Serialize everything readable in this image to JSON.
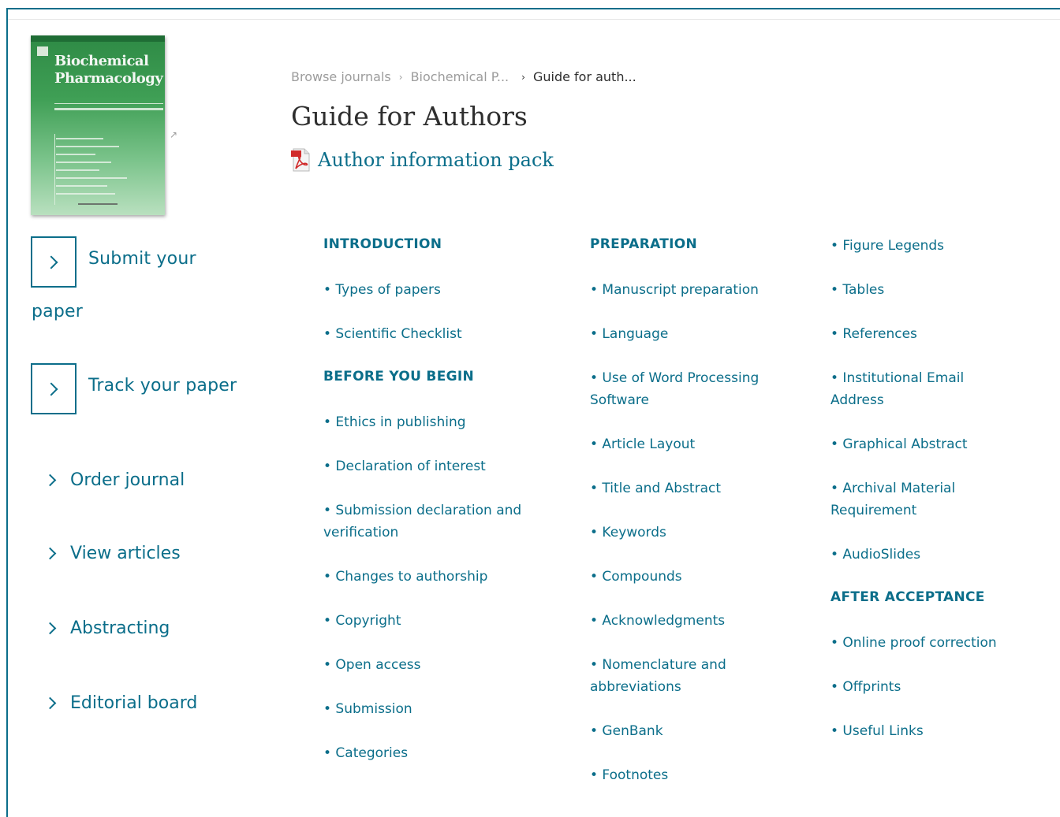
{
  "cover": {
    "title_line1": "Biochemical",
    "title_line2": "Pharmacology"
  },
  "nav": {
    "submit": "Submit your",
    "submit_cont": "paper",
    "track": "Track your paper",
    "order": "Order journal",
    "view": "View articles",
    "abstracting": "Abstracting",
    "editorial": "Editorial board"
  },
  "breadcrumb": {
    "item1": "Browse journals",
    "item2": "Biochemical P...",
    "current": "Guide for auth..."
  },
  "page_title": "Guide for Authors",
  "pack_label": "Author information pack",
  "col1": {
    "h_intro": "INTRODUCTION",
    "types": "• Types of papers",
    "checklist": "• Scientific Checklist",
    "h_before": "BEFORE YOU BEGIN",
    "ethics": "• Ethics in publishing",
    "declaration": "• Declaration of interest",
    "submission_decl": "• Submission declaration and verification",
    "changes": "• Changes to authorship",
    "copyright": "• Copyright",
    "open": "• Open access",
    "submission": "• Submission",
    "categories": "• Categories"
  },
  "col2": {
    "h_prep": "PREPARATION",
    "manuscript": "• Manuscript preparation",
    "language": "• Language",
    "word": "• Use of Word Processing Software",
    "layout": "• Article Layout",
    "title_abs": "• Title and Abstract",
    "keywords": "• Keywords",
    "compounds": "• Compounds",
    "ack": "• Acknowledgments",
    "nomen": "• Nomenclature and abbreviations",
    "genbank": "• GenBank",
    "footnotes": "• Footnotes"
  },
  "col3": {
    "figure": "• Figure Legends",
    "tables": "• Tables",
    "refs": "• References",
    "email": "• Institutional Email Address",
    "graphical": "• Graphical Abstract",
    "archival": "• Archival Material Requirement",
    "audio": "• AudioSlides",
    "h_after": "AFTER ACCEPTANCE",
    "proof": "• Online proof correction",
    "offprints": "• Offprints",
    "links": "• Useful Links"
  },
  "colors": {
    "accent": "#0b6e8a",
    "cover_green": "#3f9f55"
  },
  "icons": {
    "pdf": "pdf-icon",
    "chevron": "chevron-right-icon",
    "external": "external-link-icon"
  }
}
